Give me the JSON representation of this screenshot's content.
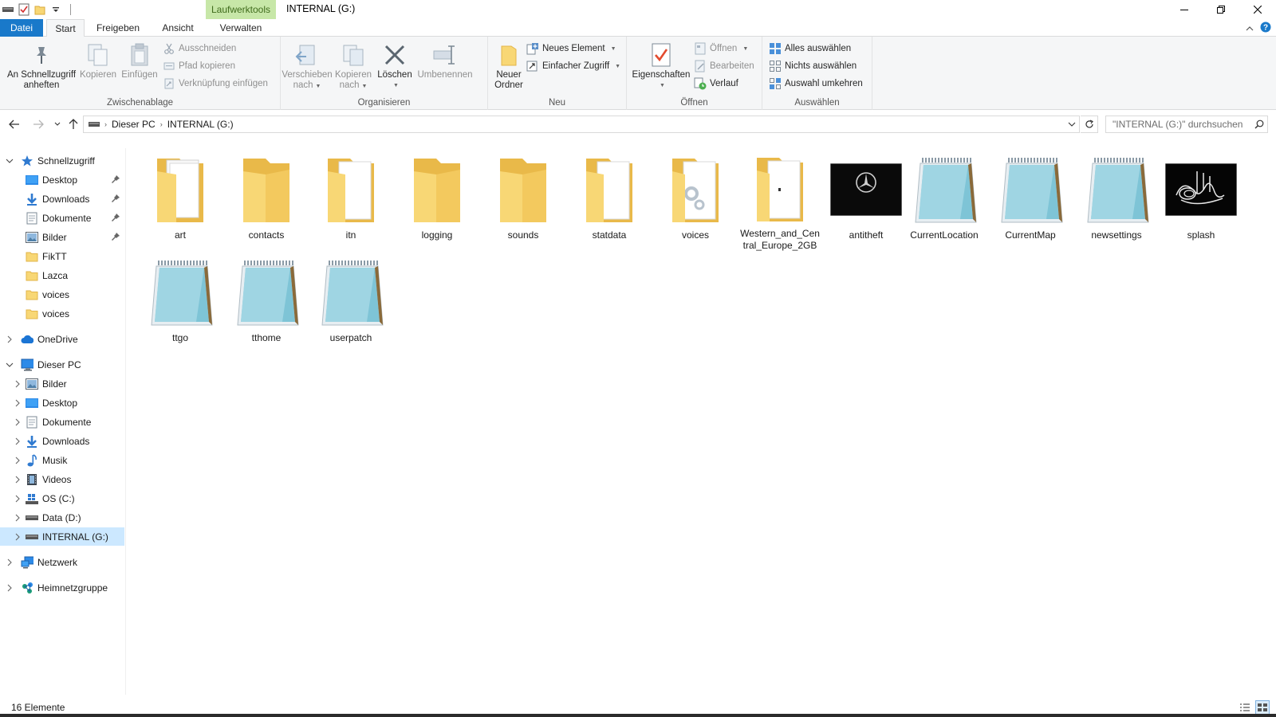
{
  "window": {
    "title": "INTERNAL (G:)",
    "context_tab_header": "Laufwerktools"
  },
  "tabs": {
    "datei": "Datei",
    "start": "Start",
    "freigeben": "Freigeben",
    "ansicht": "Ansicht",
    "verwalten": "Verwalten"
  },
  "ribbon": {
    "zwischenablage": {
      "label": "Zwischenablage",
      "pin_quick_access_l1": "An Schnellzugriff",
      "pin_quick_access_l2": "anheften",
      "copy": "Kopieren",
      "paste": "Einfügen",
      "cut": "Ausschneiden",
      "copy_path": "Pfad kopieren",
      "paste_shortcut": "Verknüpfung einfügen"
    },
    "organisieren": {
      "label": "Organisieren",
      "move_l1": "Verschieben",
      "move_l2": "nach",
      "copyto_l1": "Kopieren",
      "copyto_l2": "nach",
      "delete": "Löschen",
      "rename": "Umbenennen"
    },
    "neu": {
      "label": "Neu",
      "new_folder_l1": "Neuer",
      "new_folder_l2": "Ordner",
      "new_item": "Neues Element",
      "easy_access": "Einfacher Zugriff"
    },
    "oeffnen": {
      "label": "Öffnen",
      "properties": "Eigenschaften",
      "open": "Öffnen",
      "edit": "Bearbeiten",
      "history": "Verlauf"
    },
    "auswaehlen": {
      "label": "Auswählen",
      "select_all": "Alles auswählen",
      "select_none": "Nichts auswählen",
      "invert": "Auswahl umkehren"
    }
  },
  "address": {
    "crumbs": [
      "Dieser PC",
      "INTERNAL (G:)"
    ],
    "search_placeholder": "\"INTERNAL (G:)\" durchsuchen"
  },
  "navpane": {
    "quick_access": "Schnellzugriff",
    "quick_items": [
      "Desktop",
      "Downloads",
      "Dokumente",
      "Bilder",
      "FikTT",
      "Lazca",
      "voices",
      "voices"
    ],
    "onedrive": "OneDrive",
    "this_pc": "Dieser PC",
    "pc_items": [
      "Bilder",
      "Desktop",
      "Dokumente",
      "Downloads",
      "Musik",
      "Videos",
      "OS (C:)",
      "Data (D:)",
      "INTERNAL (G:)"
    ],
    "network": "Netzwerk",
    "homegroup": "Heimnetzgruppe"
  },
  "files": [
    {
      "name": "art",
      "type": "folder-docs"
    },
    {
      "name": "contacts",
      "type": "folder"
    },
    {
      "name": "itn",
      "type": "folder-doc"
    },
    {
      "name": "logging",
      "type": "folder"
    },
    {
      "name": "sounds",
      "type": "folder"
    },
    {
      "name": "statdata",
      "type": "folder-doc"
    },
    {
      "name": "voices",
      "type": "folder-gear"
    },
    {
      "name": "Western_and_Central_Europe_2GB",
      "type": "folder-doc"
    },
    {
      "name": "antitheft",
      "type": "image-mercedes",
      "logo_text": "Mercedes-Benz"
    },
    {
      "name": "CurrentLocation",
      "type": "notepad"
    },
    {
      "name": "CurrentMap",
      "type": "notepad"
    },
    {
      "name": "newsettings",
      "type": "notepad"
    },
    {
      "name": "splash",
      "type": "image-calligraphy"
    },
    {
      "name": "ttgo",
      "type": "notepad"
    },
    {
      "name": "tthome",
      "type": "notepad"
    },
    {
      "name": "userpatch",
      "type": "notepad"
    }
  ],
  "status": {
    "count": "16 Elemente"
  },
  "colors": {
    "accent": "#1979ca",
    "context_tab": "#c7e7a8",
    "selection": "#cce8ff",
    "folder": "#f8d775",
    "folder_dark": "#e9b949"
  }
}
